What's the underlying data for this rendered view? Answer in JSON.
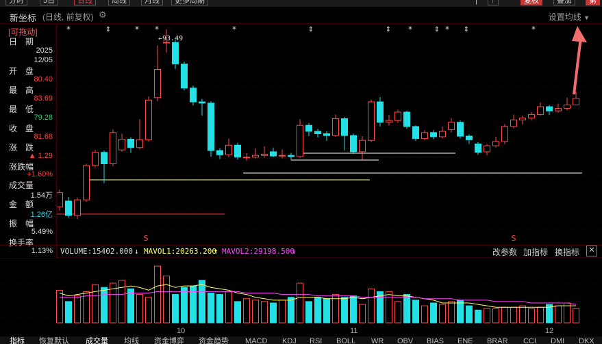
{
  "topbar": {
    "items": [
      "分时",
      "5日",
      "日线",
      "周线",
      "月线",
      "更多周期"
    ],
    "right": [
      "|",
      "↑",
      "复权",
      "叠加",
      "第"
    ]
  },
  "header": {
    "stock_name": "新坐标",
    "mode": "(日线, 前复权)",
    "settings_ma": "设置均线"
  },
  "info": {
    "drag_label": "[可拖动]",
    "rows": [
      {
        "label": "日　期",
        "value": "2025",
        "value2": "12/05",
        "color": "white"
      },
      {
        "label": "开　盘",
        "value": "80.40",
        "color": "red"
      },
      {
        "label": "最　高",
        "value": "83.69",
        "color": "red"
      },
      {
        "label": "最　低",
        "value": "79.28",
        "color": "green"
      },
      {
        "label": "收　盘",
        "value": "81.68",
        "color": "red"
      },
      {
        "label": "涨　跌",
        "value": "▲ 1.29",
        "color": "red"
      },
      {
        "label": "涨跌幅",
        "value": "+1.60%",
        "color": "red"
      },
      {
        "label": "成交量",
        "value": "1.54万",
        "color": "white"
      },
      {
        "label": "金　额",
        "value": "1.26亿",
        "color": "cyan"
      },
      {
        "label": "振　幅",
        "value": "5.49%",
        "color": "white"
      },
      {
        "label": "换手率",
        "value": "1.13%",
        "color": "white"
      }
    ]
  },
  "chart_annotation": "←93.49",
  "month_labels": [
    "10",
    "11",
    "12"
  ],
  "indicator": {
    "volume": "VOLUME:15402.000",
    "mavol1": "MAVOL1:20263.200",
    "mavol2": "MAVOL2:29198.500",
    "buttons": [
      "改参数",
      "加指标",
      "换指标"
    ]
  },
  "bottom_tabs": [
    "指标",
    "恢复默认",
    "成交量",
    "均线",
    "资金博弈",
    "资金趋势",
    "MACD",
    "KDJ",
    "RSI",
    "BOLL",
    "WR",
    "OBV",
    "BIAS",
    "ENE",
    "BRAR",
    "CCI",
    "DMI",
    "DKX"
  ],
  "colors": {
    "up": "#ff4a4a",
    "down": "#22e0e6",
    "mavol1": "#ffff66",
    "mavol2": "#ff44ff"
  },
  "chart_data": {
    "type": "candlestick",
    "candles": [
      {
        "o": 76.6,
        "c": 79.0,
        "h": 79.5,
        "l": 76.0
      },
      {
        "o": 77.6,
        "c": 75.2,
        "h": 78.3,
        "l": 74.8
      },
      {
        "o": 75.2,
        "c": 77.8,
        "h": 78.2,
        "l": 74.6
      },
      {
        "o": 77.8,
        "c": 83.5,
        "h": 83.8,
        "l": 77.5
      },
      {
        "o": 83.5,
        "c": 85.7,
        "h": 86.1,
        "l": 83.2
      },
      {
        "o": 85.7,
        "c": 83.8,
        "h": 86.0,
        "l": 80.6
      },
      {
        "o": 83.8,
        "c": 89.0,
        "h": 89.5,
        "l": 83.4
      },
      {
        "o": 86.1,
        "c": 87.9,
        "h": 88.8,
        "l": 85.8
      },
      {
        "o": 87.9,
        "c": 86.5,
        "h": 88.2,
        "l": 85.6
      },
      {
        "o": 86.5,
        "c": 87.8,
        "h": 91.2,
        "l": 86.2
      },
      {
        "o": 87.8,
        "c": 94.4,
        "h": 95.0,
        "l": 87.5
      },
      {
        "o": 94.8,
        "c": 99.5,
        "h": 103.5,
        "l": 94.2
      },
      {
        "o": 104.0,
        "c": 104.0,
        "h": 106.2,
        "l": 102.3
      },
      {
        "o": 104.0,
        "c": 100.4,
        "h": 104.4,
        "l": 99.6
      },
      {
        "o": 100.4,
        "c": 96.4,
        "h": 100.8,
        "l": 96.0
      },
      {
        "o": 96.4,
        "c": 94.1,
        "h": 96.8,
        "l": 93.5
      },
      {
        "o": 94.1,
        "c": 93.9,
        "h": 94.6,
        "l": 91.8
      },
      {
        "o": 93.9,
        "c": 86.0,
        "h": 94.2,
        "l": 85.0
      },
      {
        "o": 86.0,
        "c": 85.3,
        "h": 86.4,
        "l": 84.6
      },
      {
        "o": 85.3,
        "c": 86.9,
        "h": 88.0,
        "l": 84.9
      },
      {
        "o": 86.9,
        "c": 84.9,
        "h": 87.3,
        "l": 84.5
      },
      {
        "o": 84.9,
        "c": 84.9,
        "h": 85.6,
        "l": 84.3
      },
      {
        "o": 84.9,
        "c": 85.2,
        "h": 86.4,
        "l": 84.7
      },
      {
        "o": 85.2,
        "c": 85.4,
        "h": 86.7,
        "l": 84.8
      },
      {
        "o": 85.8,
        "c": 85.1,
        "h": 86.5,
        "l": 84.9
      },
      {
        "o": 85.1,
        "c": 85.2,
        "h": 86.2,
        "l": 84.7
      },
      {
        "o": 85.2,
        "c": 85.0,
        "h": 85.6,
        "l": 84.4
      },
      {
        "o": 85.0,
        "c": 90.2,
        "h": 91.2,
        "l": 84.8
      },
      {
        "o": 90.2,
        "c": 89.2,
        "h": 90.6,
        "l": 88.4
      },
      {
        "o": 89.2,
        "c": 88.8,
        "h": 89.6,
        "l": 88.2
      },
      {
        "o": 88.8,
        "c": 88.5,
        "h": 89.2,
        "l": 87.6
      },
      {
        "o": 88.5,
        "c": 91.3,
        "h": 92.0,
        "l": 88.3
      },
      {
        "o": 91.3,
        "c": 88.5,
        "h": 91.6,
        "l": 86.0
      },
      {
        "o": 88.5,
        "c": 85.8,
        "h": 88.8,
        "l": 85.4
      },
      {
        "o": 85.8,
        "c": 87.7,
        "h": 88.4,
        "l": 84.5
      },
      {
        "o": 87.7,
        "c": 94.1,
        "h": 94.5,
        "l": 87.4
      },
      {
        "o": 94.1,
        "c": 90.7,
        "h": 94.9,
        "l": 90.0
      },
      {
        "o": 90.7,
        "c": 91.0,
        "h": 91.9,
        "l": 90.2
      },
      {
        "o": 91.0,
        "c": 92.4,
        "h": 92.8,
        "l": 90.6
      },
      {
        "o": 92.4,
        "c": 90.0,
        "h": 92.6,
        "l": 89.6
      },
      {
        "o": 90.0,
        "c": 88.0,
        "h": 90.2,
        "l": 87.6
      },
      {
        "o": 88.0,
        "c": 89.0,
        "h": 89.4,
        "l": 87.7
      },
      {
        "o": 89.0,
        "c": 88.3,
        "h": 89.4,
        "l": 87.9
      },
      {
        "o": 88.3,
        "c": 89.2,
        "h": 90.0,
        "l": 88.0
      },
      {
        "o": 89.5,
        "c": 90.7,
        "h": 91.4,
        "l": 89.0
      },
      {
        "o": 90.7,
        "c": 88.4,
        "h": 91.0,
        "l": 88.0
      },
      {
        "o": 88.4,
        "c": 87.8,
        "h": 88.7,
        "l": 87.1
      },
      {
        "o": 87.1,
        "c": 85.7,
        "h": 87.4,
        "l": 85.3
      },
      {
        "o": 85.8,
        "c": 86.8,
        "h": 87.1,
        "l": 85.2
      },
      {
        "o": 86.8,
        "c": 87.5,
        "h": 88.3,
        "l": 86.5
      },
      {
        "o": 87.5,
        "c": 90.0,
        "h": 90.4,
        "l": 87.1
      },
      {
        "o": 90.0,
        "c": 91.1,
        "h": 92.0,
        "l": 89.7
      },
      {
        "o": 91.1,
        "c": 91.4,
        "h": 91.8,
        "l": 90.3
      },
      {
        "o": 91.4,
        "c": 92.0,
        "h": 92.4,
        "l": 91.0
      },
      {
        "o": 92.0,
        "c": 93.3,
        "h": 94.0,
        "l": 91.8
      },
      {
        "o": 93.3,
        "c": 92.6,
        "h": 93.6,
        "l": 91.9
      },
      {
        "o": 92.6,
        "c": 93.0,
        "h": 93.8,
        "l": 92.3
      },
      {
        "o": 93.0,
        "c": 93.6,
        "h": 94.8,
        "l": 92.7
      },
      {
        "o": 93.6,
        "c": 94.7,
        "h": 95.8,
        "l": 93.5
      }
    ],
    "volumes": [
      23,
      15,
      19,
      22,
      27,
      25,
      28,
      30,
      24,
      20,
      18,
      40,
      33,
      20,
      25,
      26,
      30,
      21,
      20,
      22,
      15,
      17,
      16,
      15,
      14,
      16,
      18,
      28,
      15,
      18,
      17,
      20,
      18,
      19,
      13,
      24,
      22,
      22,
      15,
      20,
      16,
      12,
      14,
      13,
      15,
      16,
      12,
      9,
      10,
      10,
      11,
      11,
      12,
      10,
      11,
      13,
      12,
      14,
      10
    ],
    "mavol1": [
      21,
      19,
      20,
      21,
      22,
      23,
      24,
      25,
      26,
      25,
      23,
      26,
      27,
      25,
      26,
      26,
      27,
      25,
      24,
      23,
      21,
      20,
      18,
      17,
      16,
      16,
      16,
      18,
      18,
      18,
      17,
      17,
      17,
      18,
      17,
      18,
      19,
      20,
      19,
      19,
      18,
      17,
      16,
      14,
      14,
      14,
      14,
      13,
      12,
      11,
      11,
      11,
      11,
      11,
      11,
      11,
      12,
      12,
      12
    ],
    "mavol2": [
      18,
      18,
      18,
      19,
      19,
      20,
      20,
      20,
      21,
      21,
      21,
      22,
      22,
      22,
      22,
      22,
      22,
      22,
      22,
      22,
      22,
      21,
      21,
      21,
      21,
      20,
      20,
      20,
      20,
      19,
      19,
      19,
      19,
      19,
      18,
      18,
      18,
      18,
      18,
      18,
      18,
      17,
      17,
      17,
      17,
      16,
      16,
      16,
      16,
      15,
      15,
      15,
      15,
      14,
      14,
      14,
      14,
      14,
      13
    ],
    "price_ylim": [
      73.5,
      106.5
    ],
    "volume_ylim": [
      0,
      42
    ]
  }
}
